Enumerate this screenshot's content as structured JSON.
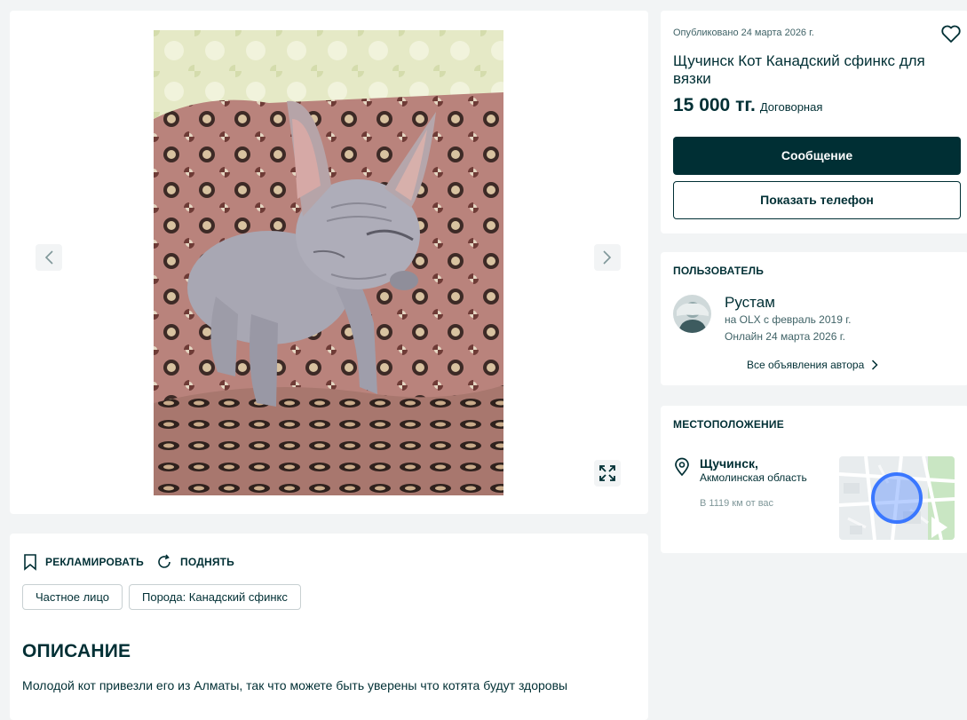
{
  "gallery": {
    "prev_icon": "chevron-left-icon",
    "next_icon": "chevron-right-icon",
    "fullscreen_icon": "expand-icon"
  },
  "actions": {
    "promote_label": "РЕКЛАМИРОВАТЬ",
    "raise_label": "ПОДНЯТЬ"
  },
  "tags": [
    "Частное лицо",
    "Порода: Канадский сфинкс"
  ],
  "description": {
    "title": "ОПИСАНИЕ",
    "text": "Молодой кот привезли его из Алматы, так что можете быть уверены что котята будут здоровы"
  },
  "offer": {
    "published": "Опубликовано 24 марта 2026 г.",
    "title": "Щучинск Кот Канадский сфинкс для вязки",
    "price": "15 000 тг.",
    "negotiable": "Договорная",
    "message_button": "Сообщение",
    "phone_button": "Показать телефон",
    "favorite_icon": "heart-icon"
  },
  "user": {
    "section_title": "ПОЛЬЗОВАТЕЛЬ",
    "name": "Рустам",
    "since": "на OLX с февраль 2019 г.",
    "online": "Онлайн 24 марта 2026 г.",
    "all_ads": "Все объявления автора"
  },
  "location": {
    "section_title": "МЕСТОПОЛОЖЕНИЕ",
    "city": "Щучинск,",
    "region": "Акмолинская область",
    "distance": "В 1119 км от вас"
  },
  "colors": {
    "primary": "#002f34",
    "page_bg": "#f2f4f5",
    "map_marker": "#3a77ff"
  }
}
